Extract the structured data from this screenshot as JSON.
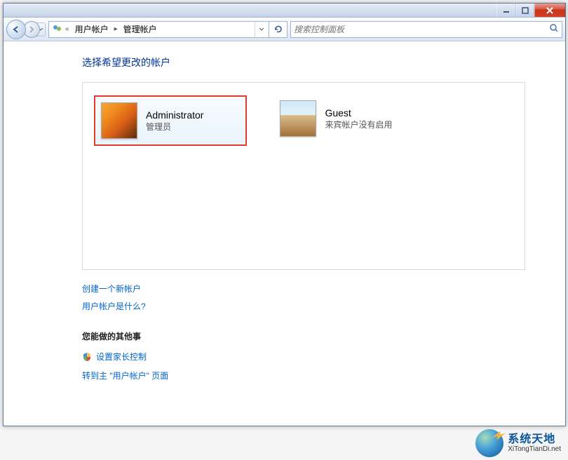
{
  "window": {
    "min_tooltip": "最小化",
    "max_tooltip": "最大化",
    "close_tooltip": "关闭"
  },
  "breadcrumb": {
    "prefix": "«",
    "seg1": "用户帐户",
    "seg2": "管理帐户"
  },
  "search": {
    "placeholder": "搜索控制面板"
  },
  "heading": "选择希望更改的帐户",
  "accounts": [
    {
      "name": "Administrator",
      "type": "管理员",
      "highlighted": true,
      "picture": "flower"
    },
    {
      "name": "Guest",
      "type": "来宾帐户没有启用",
      "highlighted": false,
      "picture": "suitcase"
    }
  ],
  "links": {
    "create": "创建一个新帐户",
    "whatis": "用户帐户是什么?"
  },
  "other_section": {
    "title": "您能做的其他事",
    "parental": "设置家长控制",
    "goto_main": "转到主 \"用户帐户\" 页面"
  },
  "watermark": {
    "title": "系统天地",
    "subtitle": "XiTongTianDi.net"
  }
}
